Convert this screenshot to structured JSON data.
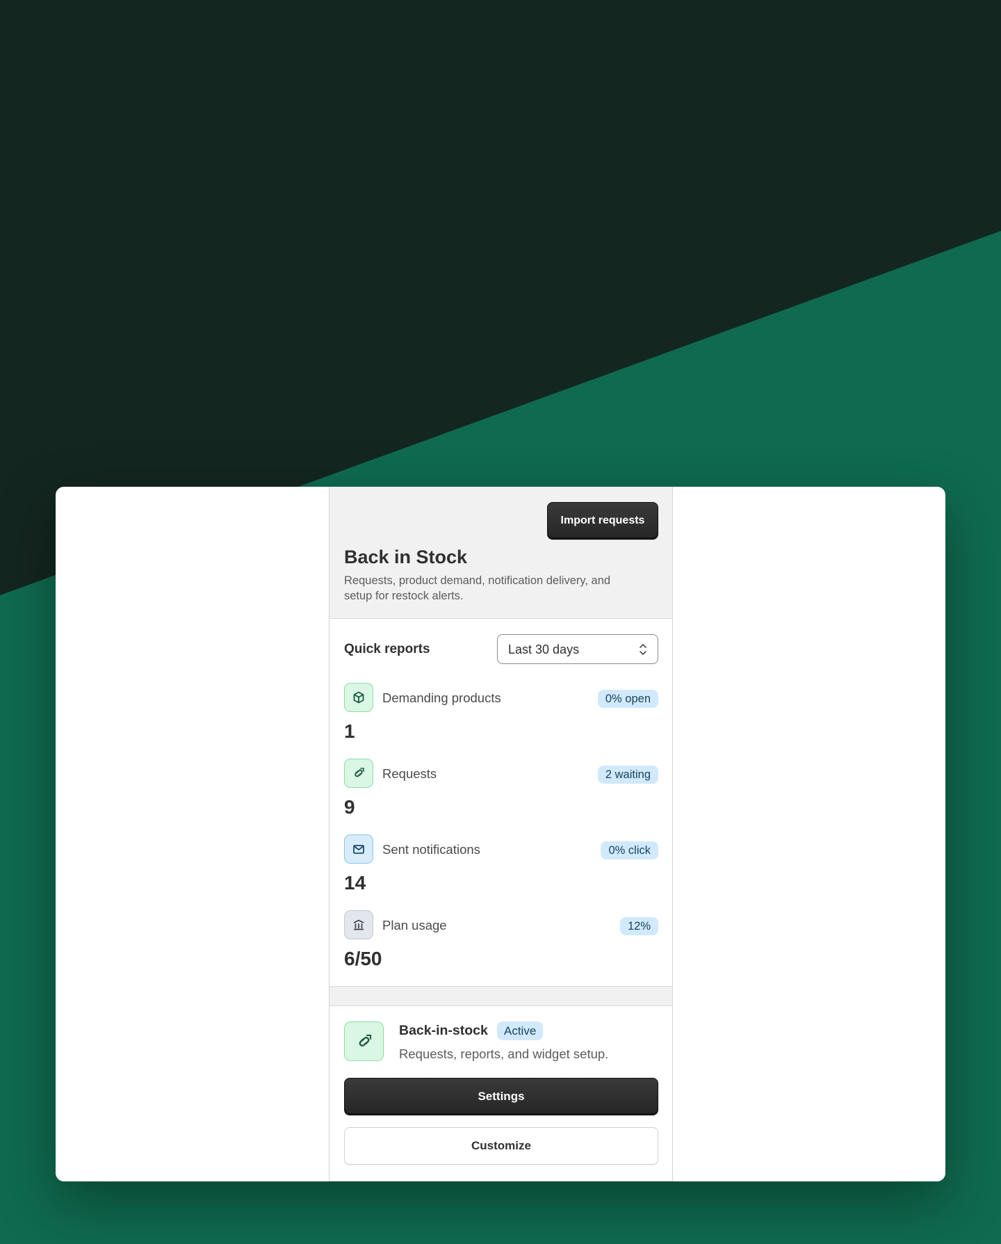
{
  "colors": {
    "background_dark": "#13261f",
    "background_green": "#0f6a4f",
    "button_dark": "#303030",
    "badge_blue": "#d1e9fb",
    "icon_green": "#d9f7e3"
  },
  "header": {
    "import_button_label": "Import requests",
    "title": "Back in Stock",
    "description": "Requests, product demand, notification delivery, and setup for restock alerts."
  },
  "quick_reports": {
    "title": "Quick reports",
    "period_select": {
      "value": "Last 30 days"
    },
    "metrics": [
      {
        "icon": "cube-icon",
        "label": "Demanding products",
        "badge": "0% open",
        "value": "1"
      },
      {
        "icon": "link-icon",
        "label": "Requests",
        "badge": "2 waiting",
        "value": "9"
      },
      {
        "icon": "mail-icon",
        "label": "Sent notifications",
        "badge": "0% click",
        "value": "14"
      },
      {
        "icon": "bank-icon",
        "label": "Plan usage",
        "badge": "12%",
        "value": "6/50"
      }
    ]
  },
  "feature": {
    "icon": "link-icon",
    "name": "Back-in-stock",
    "status": "Active",
    "description": "Requests, reports, and widget setup.",
    "settings_label": "Settings",
    "customize_label": "Customize"
  }
}
